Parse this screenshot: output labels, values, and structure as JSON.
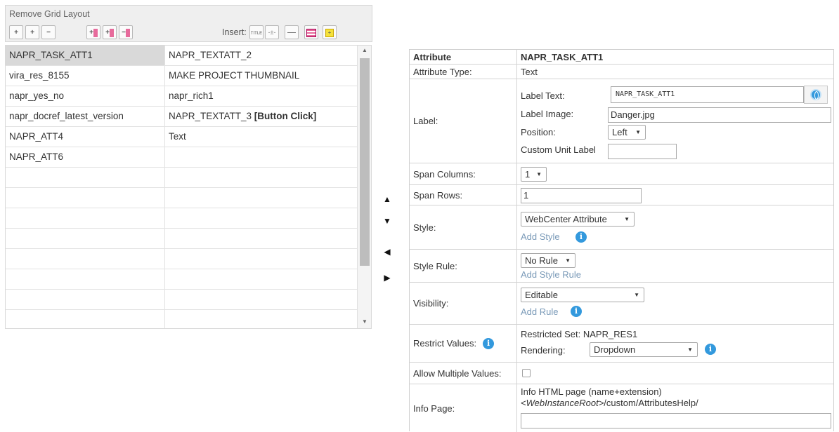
{
  "toolbar": {
    "title": "Remove Grid Layout",
    "insert_label": "Insert:",
    "title_icon_text": "TITLE"
  },
  "grid": {
    "rows": [
      {
        "left": "NAPR_TASK_ATT1",
        "right": "NAPR_TEXTATT_2",
        "suffix": ""
      },
      {
        "left": "vira_res_8155",
        "right": "MAKE PROJECT THUMBNAIL",
        "suffix": ""
      },
      {
        "left": "napr_yes_no",
        "right": "napr_rich1",
        "suffix": ""
      },
      {
        "left": "napr_docref_latest_version",
        "right": "NAPR_TEXTATT_3 ",
        "suffix": "[Button Click]"
      },
      {
        "left": "NAPR_ATT4",
        "right": "Text",
        "suffix": ""
      },
      {
        "left": "NAPR_ATT6",
        "right": "",
        "suffix": ""
      }
    ],
    "empty_rows": 8
  },
  "properties": {
    "header": {
      "label": "Attribute",
      "value": "NAPR_TASK_ATT1"
    },
    "attribute_type": {
      "label": "Attribute Type:",
      "value": "Text"
    },
    "label": {
      "label": "Label:",
      "label_text_label": "Label Text:",
      "label_text_value": "NAPR_TASK_ATT1",
      "label_image_label": "Label Image:",
      "label_image_value": "Danger.jpg",
      "position_label": "Position:",
      "position_value": "Left",
      "custom_unit_label": "Custom Unit Label",
      "custom_unit_value": ""
    },
    "span_columns": {
      "label": "Span Columns:",
      "value": "1"
    },
    "span_rows": {
      "label": "Span Rows:",
      "value": "1"
    },
    "style": {
      "label": "Style:",
      "value": "WebCenter Attribute",
      "add_link": "Add Style"
    },
    "style_rule": {
      "label": "Style Rule:",
      "value": "No Rule",
      "add_link": "Add Style Rule"
    },
    "visibility": {
      "label": "Visibility:",
      "value": "Editable",
      "add_link": "Add Rule"
    },
    "restrict_values": {
      "label": "Restrict Values:",
      "restricted_set": "Restricted Set: NAPR_RES1",
      "rendering_label": "Rendering:",
      "rendering_value": "Dropdown"
    },
    "allow_multiple": {
      "label": "Allow Multiple Values:",
      "checked": false
    },
    "info_page": {
      "label": "Info Page:",
      "line1": "Info HTML page (name+extension)",
      "line2_italic": "<WebInstanceRoot>",
      "line2_rest": "/custom/AttributesHelp/",
      "value": ""
    }
  },
  "colors": {
    "link": "#7a9ab8",
    "info_icon": "#3399dd",
    "selected_cell": "#d9d9d9",
    "pink_icon": "#e76b9c"
  }
}
